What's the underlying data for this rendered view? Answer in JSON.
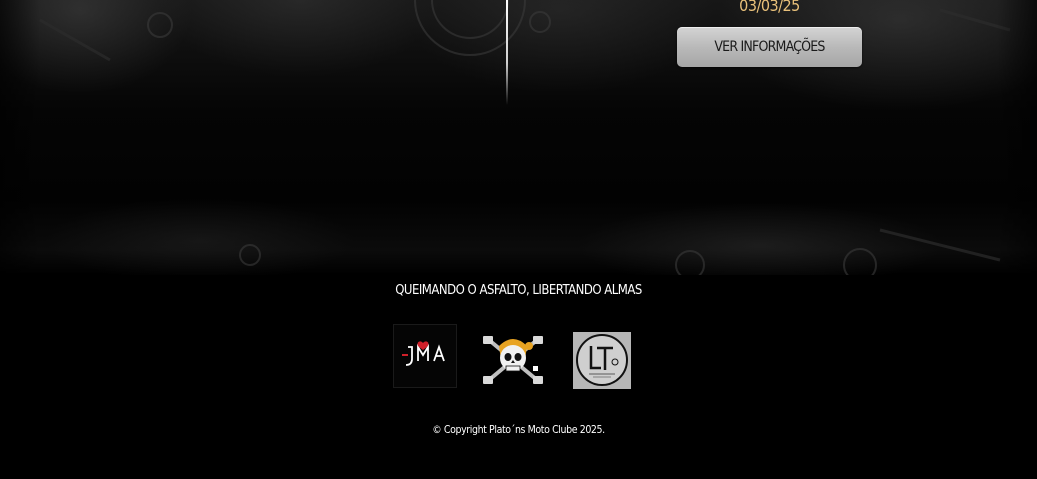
{
  "hero": {
    "event_date": "03/03/25",
    "info_button_label": "VER INFORMAÇÕES"
  },
  "footer": {
    "tagline": "QUEIMANDO O ASFALTO, LIBERTANDO ALMAS",
    "logos": [
      {
        "name": "jma-logo",
        "text": "JMA"
      },
      {
        "name": "skull-pistons-logo"
      },
      {
        "name": "lt-logo",
        "text": "LT"
      }
    ],
    "copyright": "© Copyright Plato´ns Moto Clube  2025."
  },
  "colors": {
    "date_text": "#e8c07a",
    "button_bg": "#b9b9b9",
    "background": "#000000",
    "jma_red": "#d0202a"
  }
}
